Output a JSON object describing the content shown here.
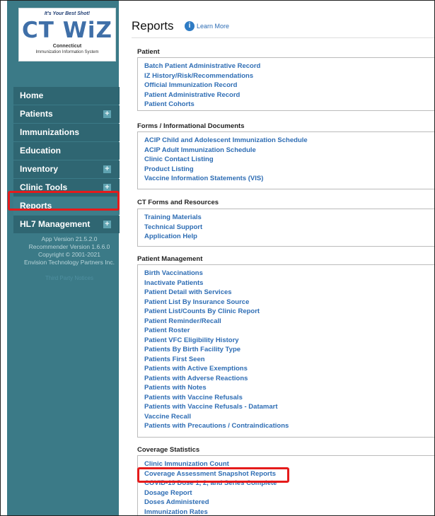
{
  "logo": {
    "tagline": "It's Your Best Shot!",
    "brand": "CT WiZ",
    "subtitle": "Connecticut",
    "subtitle2": "Immunization Information System"
  },
  "nav": {
    "home": "Home",
    "patients": "Patients",
    "immunizations": "Immunizations",
    "education": "Education",
    "inventory": "Inventory",
    "clinic_tools": "Clinic Tools",
    "reports": "Reports",
    "hl7": "HL7 Management"
  },
  "version": {
    "app": "App Version 21.5.2.0",
    "recommender": "Recommender Version 1.6.6.0",
    "copyright": "Copyright © 2001-2021",
    "company": "Envision Technology Partners Inc.",
    "third_party": "Third Party Notices"
  },
  "page": {
    "title": "Reports",
    "learn_more": "Learn More"
  },
  "sections": {
    "patient": {
      "header": "Patient",
      "items": [
        "Batch Patient Administrative Record",
        "IZ History/Risk/Recommendations",
        "Official Immunization Record",
        "Patient Administrative Record",
        "Patient Cohorts"
      ]
    },
    "forms": {
      "header": "Forms / Informational Documents",
      "items": [
        "ACIP Child and Adolescent Immunization Schedule",
        "ACIP Adult Immunization Schedule",
        "Clinic Contact Listing",
        "Product Listing",
        "Vaccine Information Statements (VIS)"
      ]
    },
    "ct_forms": {
      "header": "CT Forms and Resources",
      "items": [
        "Training Materials",
        "Technical Support",
        "Application Help"
      ]
    },
    "patient_mgmt": {
      "header": "Patient Management",
      "items": [
        "Birth Vaccinations",
        "Inactivate Patients",
        "Patient Detail with Services",
        "Patient List By Insurance Source",
        "Patient List/Counts By Clinic Report",
        "Patient Reminder/Recall",
        "Patient Roster",
        "Patient VFC Eligibility History",
        "Patients By Birth Facility Type",
        "Patients First Seen",
        "Patients with Active Exemptions",
        "Patients with Adverse Reactions",
        "Patients with Notes",
        "Patients with Vaccine Refusals",
        "Patients with Vaccine Refusals - Datamart",
        "Vaccine Recall",
        "Patients with Precautions / Contraindications"
      ]
    },
    "coverage": {
      "header": "Coverage Statistics",
      "items": [
        "Clinic Immunization Count",
        "Coverage Assessment Snapshot Reports",
        "COVID-19 Dose 1, 2, and Series Complete",
        "Dosage Report",
        "Doses Administered",
        "Immunization Rates"
      ]
    }
  },
  "colors": {
    "sidebar": "#3b7a87",
    "nav_item": "#2f6672",
    "link": "#2e6db4",
    "highlight": "#e51b1b"
  }
}
